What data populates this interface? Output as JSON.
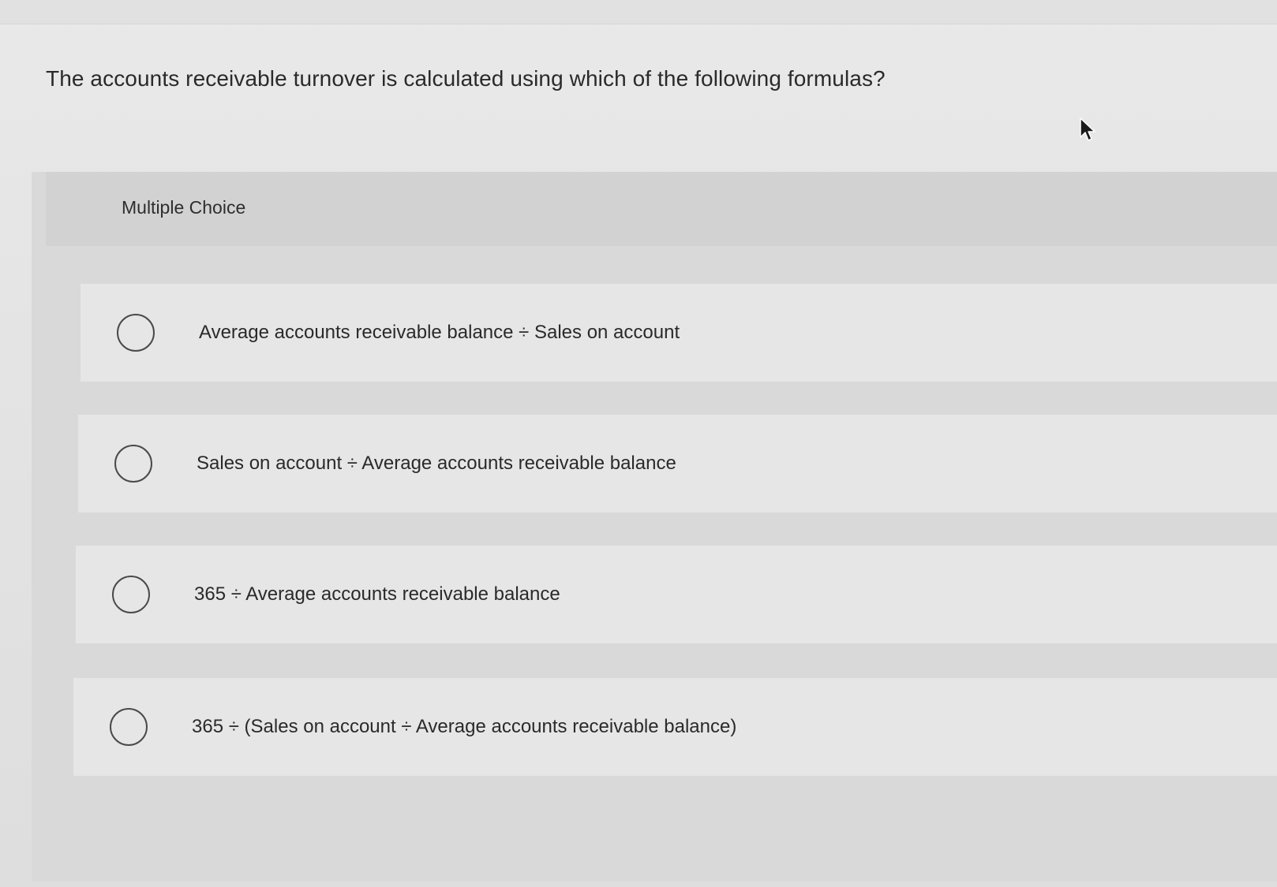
{
  "question": {
    "text": "The accounts receivable turnover is calculated using which of the following formulas?"
  },
  "multiple_choice": {
    "label": "Multiple Choice",
    "options": [
      {
        "text": "Average accounts receivable balance ÷ Sales on account",
        "selected": false
      },
      {
        "text": "Sales on account ÷ Average accounts receivable balance",
        "selected": false
      },
      {
        "text": "365 ÷ Average accounts receivable balance",
        "selected": false
      },
      {
        "text": "365 ÷ (Sales on account ÷ Average accounts receivable balance)",
        "selected": false
      }
    ]
  },
  "colors": {
    "background": "#e4e4e4",
    "panel": "#d9d9d9",
    "choice_row": "#e6e6e6",
    "text": "#2a2a2a"
  },
  "icons": {
    "cursor": "mouse-pointer-icon",
    "radio": "radio-button-icon"
  }
}
